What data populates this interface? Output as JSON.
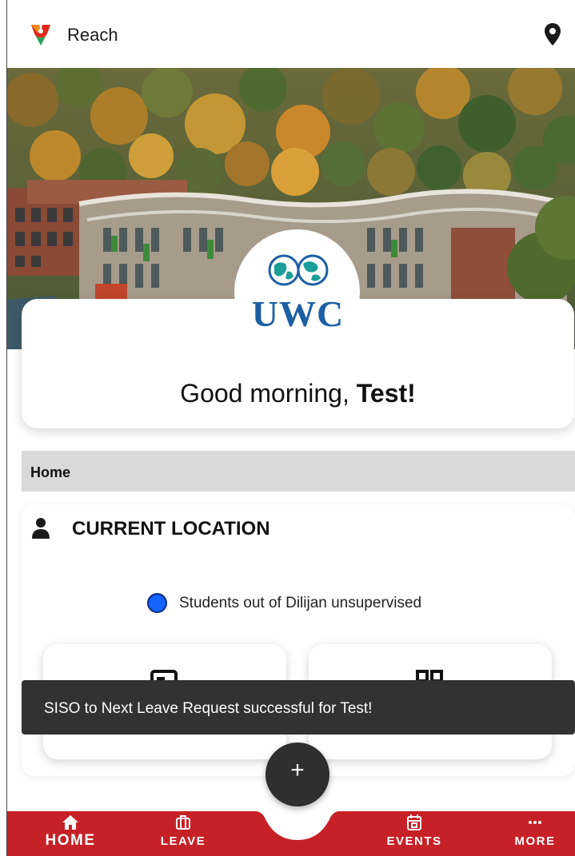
{
  "app": {
    "title": "Reach",
    "accent_color": "#c62127",
    "logo_icon": "reach-logo-icon",
    "location_icon": "map-pin-icon"
  },
  "hero": {
    "school_logo_text": "UWC",
    "school_logo_colors": [
      "#1d5fa5",
      "#1b9e9a"
    ]
  },
  "greeting": {
    "prefix": "Good morning, ",
    "name": "Test!"
  },
  "breadcrumb": {
    "label": "Home"
  },
  "location_card": {
    "title": "CURRENT LOCATION",
    "title_icon": "person-icon",
    "legend": {
      "label": "Students out of Dilijan unsupervised",
      "color": "#1463ff"
    },
    "tiles": [
      {
        "icon": "id-card-icon"
      },
      {
        "icon": "grid-icon"
      }
    ]
  },
  "snackbar": {
    "message": "SISO to Next Leave Request successful for Test!"
  },
  "fab": {
    "label": "+",
    "icon": "plus-icon"
  },
  "bottom_nav": {
    "color": "#c62127",
    "items": [
      {
        "label": "HOME",
        "icon": "home-icon",
        "active": true
      },
      {
        "label": "LEAVE",
        "icon": "briefcase-icon",
        "active": false
      },
      {
        "label": "EVENTS",
        "icon": "calendar-icon",
        "active": false
      },
      {
        "label": "MORE",
        "icon": "more-dots-icon",
        "active": false
      }
    ]
  }
}
